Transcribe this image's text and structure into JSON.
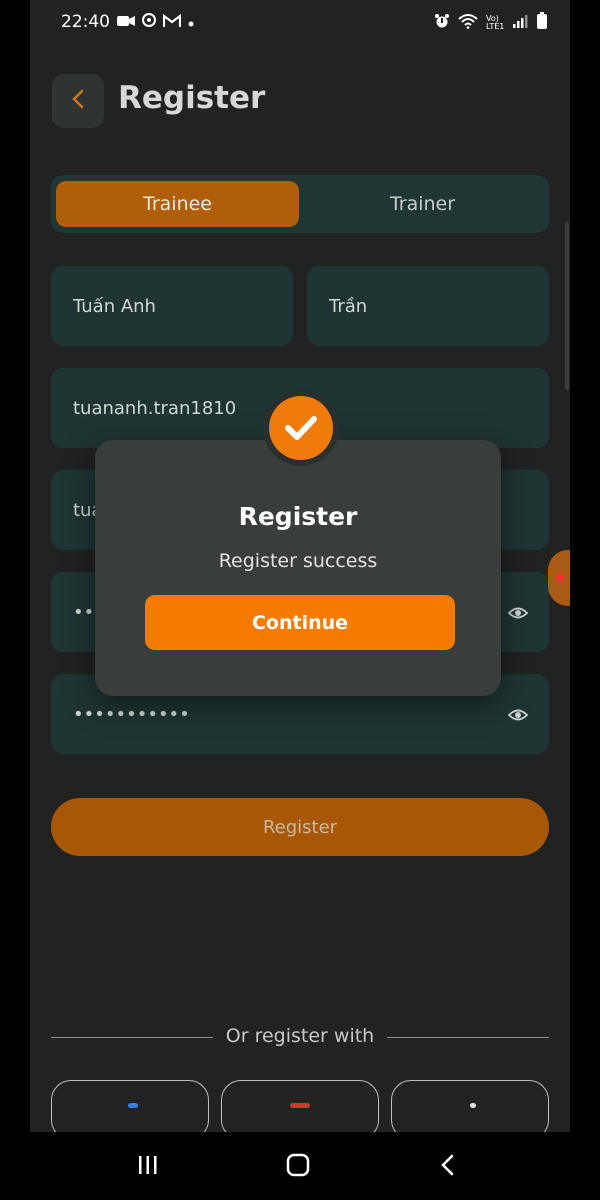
{
  "statusbar": {
    "time": "22:40",
    "network_label": "Vo) LTE1"
  },
  "header": {
    "title": "Register",
    "back_icon": "chevron-left-icon"
  },
  "role_toggle": {
    "options": [
      "Trainee",
      "Trainer"
    ],
    "selected": "Trainee"
  },
  "form": {
    "first_name": "Tuấn Anh",
    "last_name": "Trần",
    "username": "tuananh.tran1810",
    "email": "tua",
    "password": "••••",
    "confirm_password": "•••••••••••"
  },
  "register_button": {
    "label": "Register"
  },
  "divider": {
    "text": "Or register with"
  },
  "dialog": {
    "title": "Register",
    "message": "Register success",
    "button": "Continue",
    "icon": "check-circle-icon"
  },
  "colors": {
    "accent": "#f57c00",
    "background": "#202321",
    "field": "#1e3534"
  }
}
